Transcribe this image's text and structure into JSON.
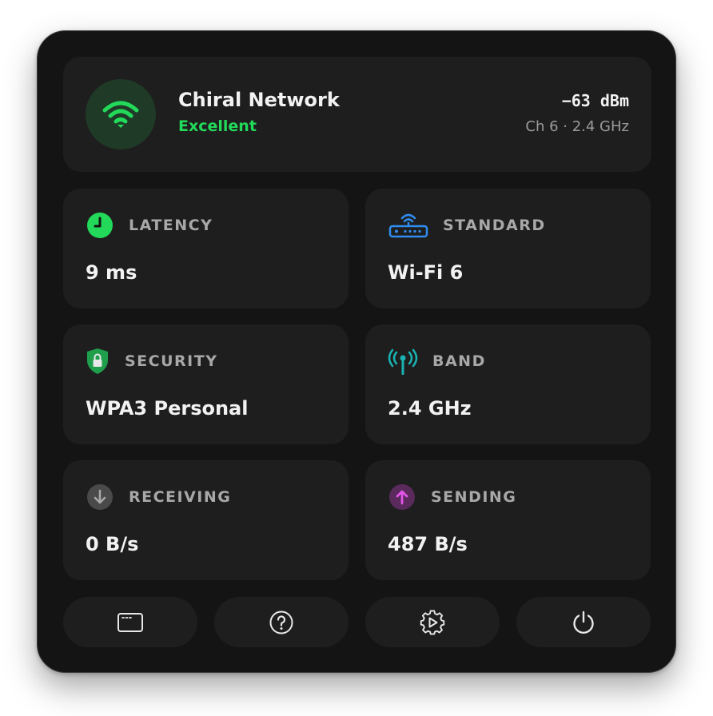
{
  "header": {
    "network_name": "Chiral Network",
    "quality": "Excellent",
    "signal_strength": "−63 dBm",
    "channel_info": "Ch 6 · 2.4 GHz"
  },
  "tiles": [
    {
      "label": "LATENCY",
      "value": "9 ms",
      "icon": "clock-icon"
    },
    {
      "label": "STANDARD",
      "value": "Wi-Fi 6",
      "icon": "router-icon"
    },
    {
      "label": "SECURITY",
      "value": "WPA3 Personal",
      "icon": "shield-lock-icon"
    },
    {
      "label": "BAND",
      "value": "2.4 GHz",
      "icon": "antenna-icon"
    },
    {
      "label": "RECEIVING",
      "value": "0 B/s",
      "icon": "arrow-down-icon"
    },
    {
      "label": "SENDING",
      "value": "487 B/s",
      "icon": "arrow-up-icon"
    }
  ],
  "toolbar": [
    {
      "icon": "window-icon"
    },
    {
      "icon": "help-icon"
    },
    {
      "icon": "settings-icon"
    },
    {
      "icon": "power-icon"
    }
  ],
  "colors": {
    "accent_green": "#22d95a",
    "router_blue": "#2f8cf0",
    "antenna_teal": "#1ab3b3",
    "send_magenta": "#d14bd6",
    "receive_gray": "#4a4a4a",
    "shield_green": "#1f9e4b"
  }
}
